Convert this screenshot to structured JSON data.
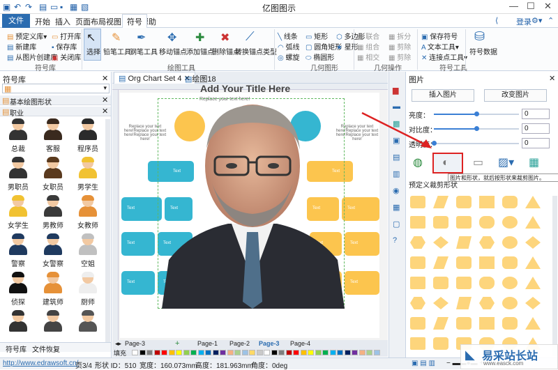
{
  "app": {
    "title": "亿图图示",
    "login": "登录",
    "window_buttons": [
      "—",
      "☐",
      "✕"
    ]
  },
  "menu": [
    "文件",
    "开始",
    "插入",
    "页面布局",
    "视图",
    "符号",
    "帮助"
  ],
  "ribbon": {
    "symbol_lib_group": {
      "items": [
        "预定义库",
        "新建库",
        "从图片创建库",
        "打开库",
        "保存库",
        "关闭库"
      ],
      "label": "符号库"
    },
    "drawing_tools": {
      "items": [
        "选择",
        "铅笔工具",
        "钢笔工具",
        "移动锚点",
        "添加锚点",
        "删除锚点",
        "转换锚点类型"
      ],
      "label": "绘图工具"
    },
    "geometry": {
      "items": [
        "线条",
        "弧线",
        "螺旋",
        "矩形",
        "圆角矩形",
        "椭圆形",
        "多边形",
        "星形"
      ],
      "label": "几何图形"
    },
    "geo_ops": {
      "items": [
        "联合",
        "组合",
        "相交",
        "拆分",
        "剪除",
        "剪除"
      ],
      "label": "几何操作"
    },
    "symbol_tools": {
      "items": [
        "保存符号",
        "文本工具",
        "连接点工具"
      ],
      "label": "符号工具"
    },
    "symbol_data": "符号数据"
  },
  "left_panel": {
    "title": "符号库",
    "categories": [
      "基本绘图形状",
      "职业"
    ],
    "items": [
      {
        "label": "总裁",
        "color": "#333333"
      },
      {
        "label": "客服",
        "color": "#3a2a1e"
      },
      {
        "label": "程序员",
        "color": "#2b2b2b"
      },
      {
        "label": "男职员",
        "color": "#333333"
      },
      {
        "label": "女职员",
        "color": "#5a3a1e"
      },
      {
        "label": "男学生",
        "color": "#f1c232"
      },
      {
        "label": "女学生",
        "color": "#f1c232"
      },
      {
        "label": "男教师",
        "color": "#3a3a3a"
      },
      {
        "label": "女教师",
        "color": "#e69138"
      },
      {
        "label": "警察",
        "color": "#1f3a5f"
      },
      {
        "label": "女警察",
        "color": "#1f3a5f"
      },
      {
        "label": "空姐",
        "color": "#c0c0c0"
      },
      {
        "label": "侦探",
        "color": "#111111"
      },
      {
        "label": "建筑师",
        "color": "#e69138"
      },
      {
        "label": "厨师",
        "color": "#eeeeee"
      },
      {
        "label": "",
        "color": "#333333"
      },
      {
        "label": "",
        "color": "#444444"
      },
      {
        "label": "",
        "color": "#555555"
      }
    ],
    "bottom_tabs": [
      "符号库",
      "文件恢复"
    ]
  },
  "doc_tabs": [
    "Org Chart Set 4",
    "绘图18"
  ],
  "canvas": {
    "title_text": "Add Your Title Here",
    "subtitle": "Replace your text here!",
    "side_left": "Replace your text here!Replace your text here!Replace your text here!",
    "side_right": "Replace your text here!Replace your text here!Replace your text here!",
    "box_text": "Text"
  },
  "right_panel": {
    "title": "图片",
    "insert_btn": "插入图片",
    "change_btn": "改变图片",
    "sliders": [
      {
        "label": "亮度：",
        "value": "0",
        "level": 0.5
      },
      {
        "label": "对比度：",
        "value": "0",
        "level": 0.5
      },
      {
        "label": "透明度：",
        "value": "0",
        "level": 0.0
      }
    ],
    "tooltip": "图片和形状，就后按形状来裁剪图片。",
    "section": "预定义裁剪形状",
    "shape_color": "#fdd57c"
  },
  "pages": [
    "Page-3",
    "Page-1",
    "Page-2",
    "Page-3",
    "Page-4"
  ],
  "fill_label": "填充",
  "status": {
    "url": "http://www.edrawsoft.cn/",
    "page": "页3/4",
    "shape_id": "形状 ID：510",
    "width": "宽度：160.073mm",
    "height": "高度：181.963mm",
    "angle": "角度：0deg"
  },
  "watermark": "易采站长站",
  "watermark_url": "www.easck.com"
}
